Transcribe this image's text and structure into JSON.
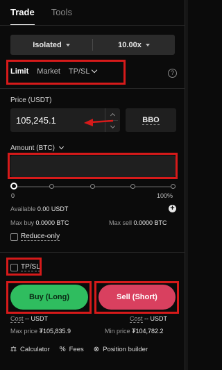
{
  "tabs": [
    {
      "label": "Trade",
      "active": true
    },
    {
      "label": "Tools",
      "active": false
    }
  ],
  "mode": {
    "margin_mode": "Isolated",
    "leverage": "10.00x"
  },
  "order_types": [
    {
      "label": "Limit",
      "active": true
    },
    {
      "label": "Market",
      "active": false
    },
    {
      "label": "TP/SL",
      "active": false
    }
  ],
  "help_icon": "question-circle-icon",
  "price": {
    "label": "Price (USDT)",
    "value": "105,245.1",
    "bbo_label": "BBO"
  },
  "amount": {
    "label": "Amount (BTC)",
    "value": ""
  },
  "slider": {
    "value_percent": 0,
    "min_label": "0",
    "max_label": "100%"
  },
  "available": {
    "label": "Available",
    "value": "0.00 USDT"
  },
  "max_buy": {
    "label": "Max buy",
    "value": "0.0000 BTC"
  },
  "max_sell": {
    "label": "Max sell",
    "value": "0.0000 BTC"
  },
  "reduce_only": {
    "label": "Reduce-only",
    "checked": false
  },
  "tpsl": {
    "label": "TP/SL",
    "checked": false
  },
  "buy": {
    "label": "Buy (Long)",
    "cost_label": "Cost",
    "cost_value": "-- USDT",
    "max_price_label": "Max price",
    "max_price_value": "₮105,835.9"
  },
  "sell": {
    "label": "Sell (Short)",
    "cost_label": "Cost",
    "cost_value": "-- USDT",
    "min_price_label": "Min price",
    "min_price_value": "₮104,782.2"
  },
  "bottom": [
    {
      "icon": "calculator-icon",
      "label": "Calculator"
    },
    {
      "icon": "percent-icon",
      "label": "Fees"
    },
    {
      "icon": "position-builder-icon",
      "label": "Position builder"
    }
  ],
  "colors": {
    "buy": "#2fbd5f",
    "sell": "#d9405f",
    "highlight": "#d61a1a",
    "background": "#0b0b0b"
  }
}
